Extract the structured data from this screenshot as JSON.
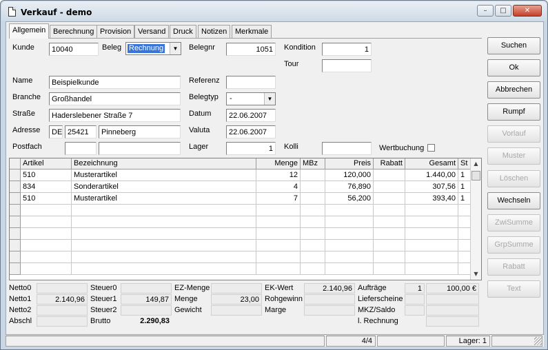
{
  "window": {
    "title": "Verkauf - demo",
    "minimize": "–",
    "maximize": "□",
    "close": "✕"
  },
  "tabs": [
    "Allgemein",
    "Berechnung",
    "Provision",
    "Versand",
    "Druck",
    "Notizen",
    "Merkmale"
  ],
  "form": {
    "kunde_label": "Kunde",
    "kunde_value": "10040",
    "beleg_label": "Beleg",
    "beleg_value": "Rechnung",
    "belegnr_label": "Belegnr",
    "belegnr_value": "1051",
    "kondition_label": "Kondition",
    "kondition_value": "1",
    "tour_label": "Tour",
    "tour_value": "",
    "name_label": "Name",
    "name_value": "Beispielkunde",
    "referenz_label": "Referenz",
    "referenz_value": "",
    "branche_label": "Branche",
    "branche_value": "Großhandel",
    "belegtyp_label": "Belegtyp",
    "belegtyp_value": "-",
    "strasse_label": "Straße",
    "strasse_value": "Haderslebener Straße 7",
    "datum_label": "Datum",
    "datum_value": "22.06.2007",
    "adresse_label": "Adresse",
    "land_value": "DE",
    "plz_value": "25421",
    "ort_value": "Pinneberg",
    "valuta_label": "Valuta",
    "valuta_value": "22.06.2007",
    "postfach_label": "Postfach",
    "postfach_value": "",
    "postfach_plz_value": "",
    "lager_label": "Lager",
    "lager_value": "1",
    "kolli_label": "Kolli",
    "kolli_value": "",
    "wertbuchung_label": "Wertbuchung"
  },
  "buttons": [
    {
      "label": "Suchen",
      "enabled": true
    },
    {
      "label": "Ok",
      "enabled": true
    },
    {
      "label": "Abbrechen",
      "enabled": true
    },
    {
      "label": "Rumpf",
      "enabled": true
    },
    {
      "label": "Vorlauf",
      "enabled": false
    },
    {
      "label": "Muster",
      "enabled": false
    },
    {
      "label": "Löschen",
      "enabled": false
    },
    {
      "label": "Wechseln",
      "enabled": true
    },
    {
      "label": "ZwiSumme",
      "enabled": false
    },
    {
      "label": "GrpSumme",
      "enabled": false
    },
    {
      "label": "Rabatt",
      "enabled": false
    },
    {
      "label": "Text",
      "enabled": false
    }
  ],
  "grid": {
    "columns": [
      "Artikel",
      "Bezeichnung",
      "Menge",
      "MBz",
      "Preis",
      "Rabatt",
      "Gesamt",
      "St"
    ],
    "rows": [
      [
        "510",
        "Musterartikel",
        "12",
        "",
        "120,000",
        "",
        "1.440,00",
        "1"
      ],
      [
        "834",
        "Sonderartikel",
        "4",
        "",
        "76,890",
        "",
        "307,56",
        "1"
      ],
      [
        "510",
        "Musterartikel",
        "7",
        "",
        "56,200",
        "",
        "393,40",
        "1"
      ]
    ]
  },
  "totals": {
    "netto0_label": "Netto0",
    "netto0_value": "",
    "netto1_label": "Netto1",
    "netto1_value": "2.140,96",
    "netto2_label": "Netto2",
    "netto2_value": "",
    "abschl_label": "Abschl",
    "abschl_value": "",
    "steuer0_label": "Steuer0",
    "steuer0_value": "",
    "steuer1_label": "Steuer1",
    "steuer1_value": "149,87",
    "steuer2_label": "Steuer2",
    "steuer2_value": "",
    "brutto_label": "Brutto",
    "brutto_value": "2.290,83",
    "ezmenge_label": "EZ-Menge",
    "ezmenge_value": "",
    "menge_label": "Menge",
    "menge_value": "23,00",
    "gewicht_label": "Gewicht",
    "gewicht_value": "",
    "ekwert_label": "EK-Wert",
    "ekwert_value": "2.140,96",
    "rohgewinn_label": "Rohgewinn",
    "rohgewinn_value": "",
    "marge_label": "Marge",
    "marge_value": "",
    "auftraege_label": "Aufträge",
    "auftraege_count": "1",
    "auftraege_value": "100,00 €",
    "lieferscheine_label": "Lieferscheine",
    "mkz_label": "MKZ/Saldo",
    "rechnung_label": "l. Rechnung"
  },
  "status": {
    "page": "4/4",
    "lager": "Lager: 1"
  }
}
